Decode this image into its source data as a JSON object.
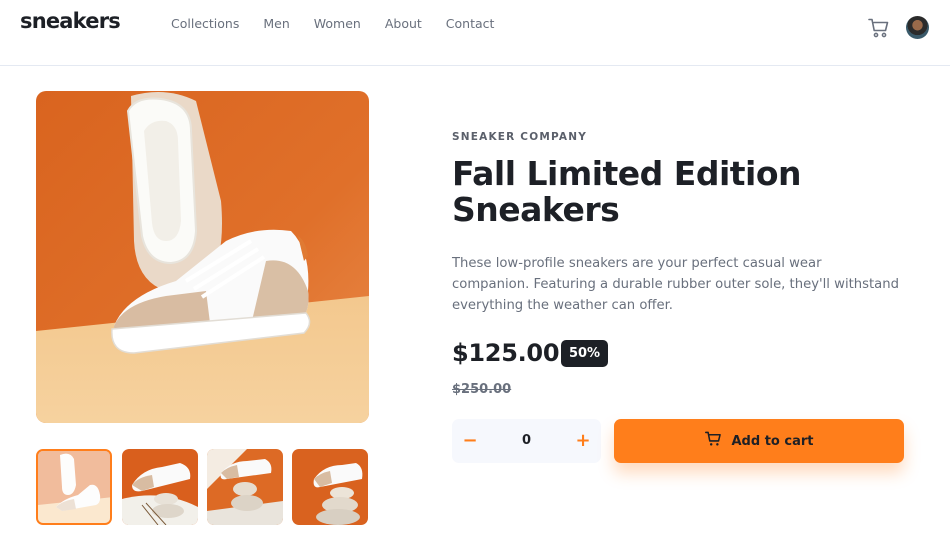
{
  "header": {
    "logo": "sneakers",
    "nav": [
      "Collections",
      "Men",
      "Women",
      "About",
      "Contact"
    ]
  },
  "product": {
    "company": "SNEAKER COMPANY",
    "title": "Fall Limited Edition Sneakers",
    "description": "These low-profile sneakers are your perfect casual wear companion. Featuring a durable rubber outer sole, they'll withstand everything the weather can offer.",
    "price": "$125.00",
    "discount": "50%",
    "old_price": "$250.00"
  },
  "cart": {
    "minus": "−",
    "quantity": "0",
    "plus": "+",
    "add_label": "Add to cart"
  },
  "colors": {
    "accent": "#ff7e1b",
    "dark": "#1d2026",
    "grey": "#69707d"
  }
}
